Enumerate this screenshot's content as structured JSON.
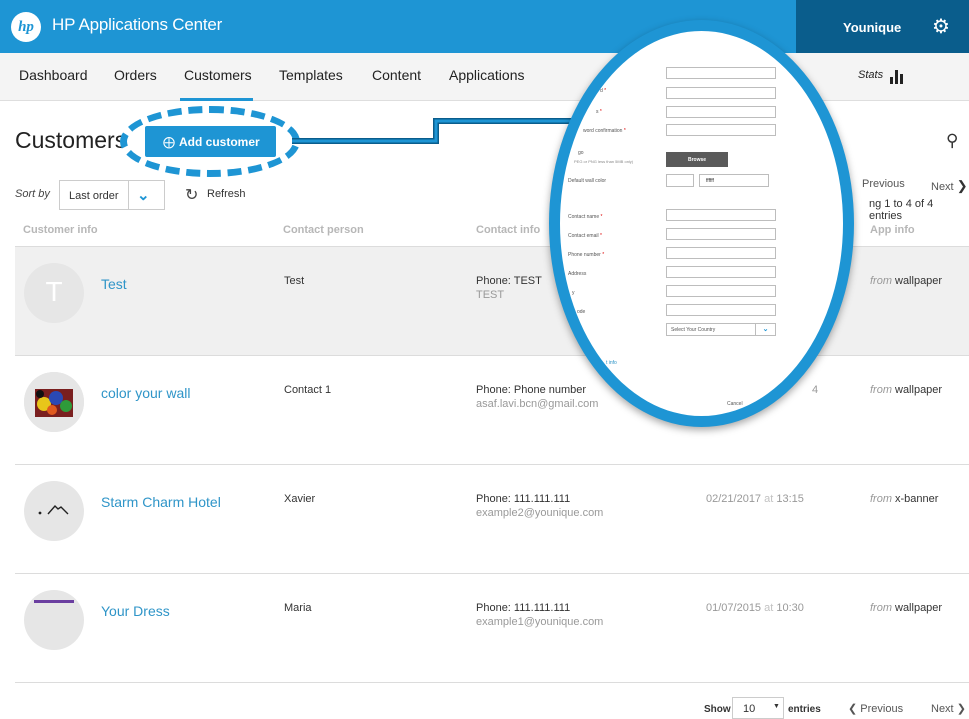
{
  "header": {
    "logo_text": "hp",
    "app_title": "HP Applications Center",
    "user_name": "Younique",
    "settings_icon": "gear-icon"
  },
  "nav": {
    "items": [
      "Dashboard",
      "Orders",
      "Customers",
      "Templates",
      "Content",
      "Applications"
    ],
    "active": "Customers",
    "stats_label": "Stats"
  },
  "page": {
    "title": "Customers",
    "add_button": "Add customer",
    "sort_label": "Sort by",
    "sort_value": "Last order",
    "refresh_label": "Refresh",
    "top_prev": "Previous",
    "top_next": "Next",
    "showing_text": "ng 1 to 4 of 4 entries"
  },
  "table": {
    "columns": [
      "Customer info",
      "Contact person",
      "Contact info",
      "App info"
    ],
    "rows": [
      {
        "initial": "T",
        "name": "Test",
        "contact": "Test",
        "phone": "Phone: TEST",
        "email": "TEST",
        "date": "",
        "time": "",
        "from_label": "from",
        "source": "wallpaper"
      },
      {
        "initial": "",
        "name": "color your wall",
        "contact": "Contact 1",
        "phone": "Phone: Phone number",
        "email": "asaf.lavi.bcn@gmail.com",
        "date_partial": "4",
        "from_label": "from",
        "source": "wallpaper"
      },
      {
        "initial": "",
        "name": "Starm Charm Hotel",
        "contact": "Xavier",
        "phone": "Phone: 111.111.111",
        "email": "example2@younique.com",
        "date": "02/21/2017",
        "at": "at",
        "time": "13:15",
        "from_label": "from",
        "source": "x-banner"
      },
      {
        "initial": "",
        "name": "Your Dress",
        "contact": "Maria",
        "phone": "Phone: 111.111.111",
        "email": "example1@younique.com",
        "date": "01/07/2015",
        "at": "at",
        "time": "10:30",
        "from_label": "from",
        "source": "wallpaper"
      }
    ]
  },
  "footer": {
    "show_label": "Show",
    "page_size": "10",
    "entries_label": "entries",
    "prev": "Previous",
    "next": "Next"
  },
  "magnifier": {
    "labels": {
      "l2": "d",
      "l3": "s",
      "password_confirmation": "word confirmation",
      "logo": "go",
      "logo_hint": "PEG or PNG less than 5MB only)",
      "default_wall_color": "Default wall color",
      "contact_name": "Contact name",
      "contact_email": "Contact email",
      "phone_number": "Phone number",
      "address": "Address",
      "city": "y",
      "zip": "ode"
    },
    "browse_label": "Browse",
    "color_value": "ffffff",
    "country_placeholder": "Select Your Country",
    "more_info_link": "t info",
    "cancel_label": "Cancel"
  },
  "colors": {
    "brand_blue": "#1e95d4",
    "user_box": "#0a5d8c",
    "link_blue": "#2f95c8"
  }
}
